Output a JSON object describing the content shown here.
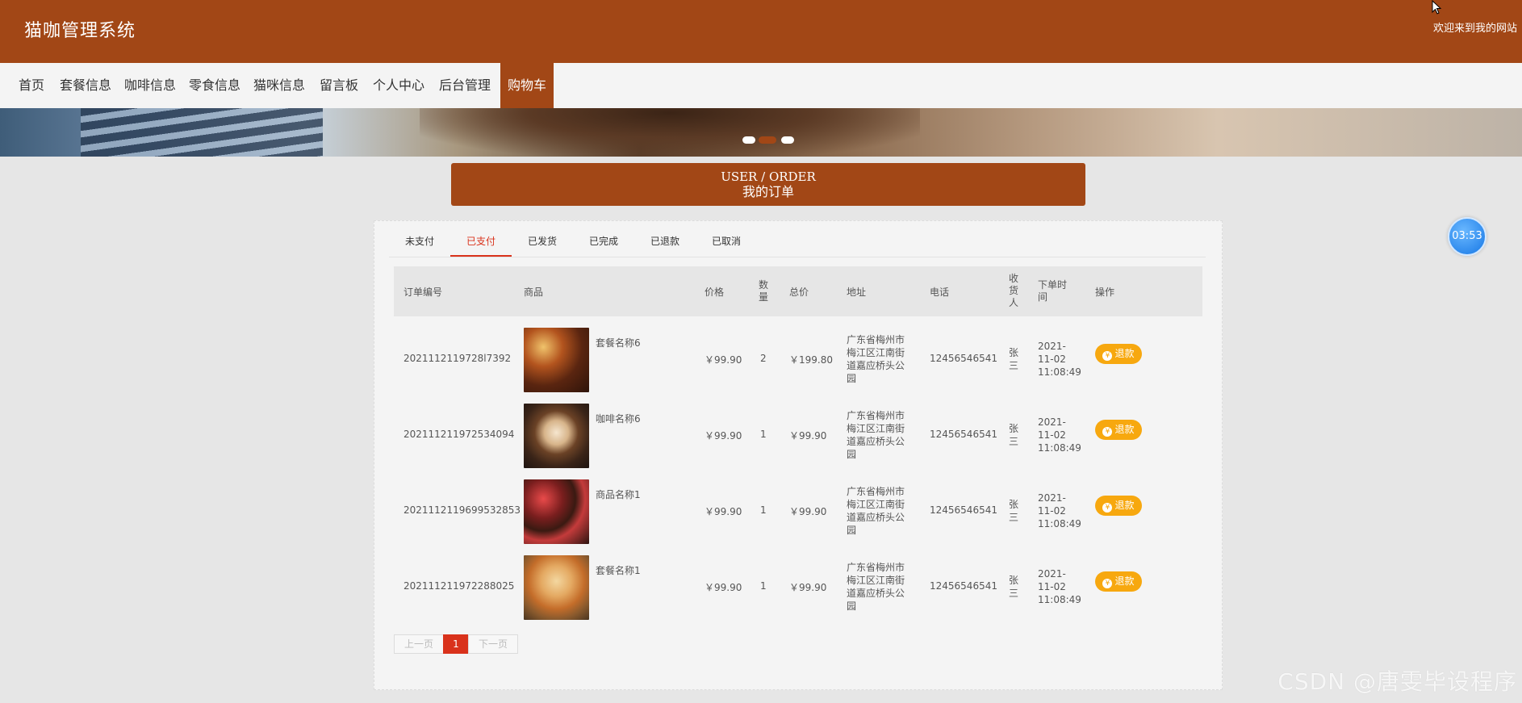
{
  "header": {
    "title": "猫咖管理系统",
    "welcome": "欢迎来到我的网站"
  },
  "nav": {
    "items": [
      {
        "label": "首页"
      },
      {
        "label": "套餐信息"
      },
      {
        "label": "咖啡信息"
      },
      {
        "label": "零食信息"
      },
      {
        "label": "猫咪信息"
      },
      {
        "label": "留言板"
      },
      {
        "label": "个人中心"
      },
      {
        "label": "后台管理"
      },
      {
        "label": "购物车"
      }
    ],
    "active_index": 8
  },
  "heading": {
    "en": "USER / ORDER",
    "cn": "我的订单"
  },
  "timer": "03:53",
  "tabs": {
    "items": [
      {
        "label": "未支付"
      },
      {
        "label": "已支付"
      },
      {
        "label": "已发货"
      },
      {
        "label": "已完成"
      },
      {
        "label": "已退款"
      },
      {
        "label": "已取消"
      }
    ],
    "active_index": 1
  },
  "table": {
    "headers": {
      "order_no": "订单编号",
      "product": "商品",
      "price": "价格",
      "qty": "数量",
      "total": "总价",
      "address": "地址",
      "phone": "电话",
      "receiver": "收货人",
      "time": "下单时间",
      "action": "操作"
    },
    "rows": [
      {
        "order_no": "2021112119728l7392",
        "product": "套餐名称6",
        "price": "￥99.90",
        "qty": "2",
        "total": "￥199.80",
        "address": "广东省梅州市梅江区江南街道嘉应桥头公园",
        "phone": "12456546541",
        "receiver": "张三",
        "date": "2021-11-02",
        "time": "11:08:49",
        "action": "退款",
        "image": "food-hotpot"
      },
      {
        "order_no": "2021112119725340​94",
        "product": "咖啡名称6",
        "price": "￥99.90",
        "qty": "1",
        "total": "￥99.90",
        "address": "广东省梅州市梅江区江南街道嘉应桥头公园",
        "phone": "12456546541",
        "receiver": "张三",
        "date": "2021-11-02",
        "time": "11:08:49",
        "action": "退款",
        "image": "coffee-latte"
      },
      {
        "order_no": "20211121196995328​53",
        "product": "商品名称1",
        "price": "￥99.90",
        "qty": "1",
        "total": "￥99.90",
        "address": "广东省梅州市梅江区江南街道嘉应桥头公园",
        "phone": "12456546541",
        "receiver": "张三",
        "date": "2021-11-02",
        "time": "11:08:49",
        "action": "退款",
        "image": "chocolates"
      },
      {
        "order_no": "20211121197228802​5",
        "product": "套餐名称1",
        "price": "￥99.90",
        "qty": "1",
        "total": "￥99.90",
        "address": "广东省梅州市梅江区江南街道嘉应桥头公园",
        "phone": "12456546541",
        "receiver": "张三",
        "date": "2021-11-02",
        "time": "11:08:49",
        "action": "退款",
        "image": "shrimp-dish"
      }
    ]
  },
  "pager": {
    "prev": "上一页",
    "current": "1",
    "next": "下一页"
  },
  "watermark": "CSDN @唐雯毕设程序",
  "colors": {
    "brand": "#a24716",
    "tab_active": "#d9321b",
    "refund": "#f7a80f"
  }
}
